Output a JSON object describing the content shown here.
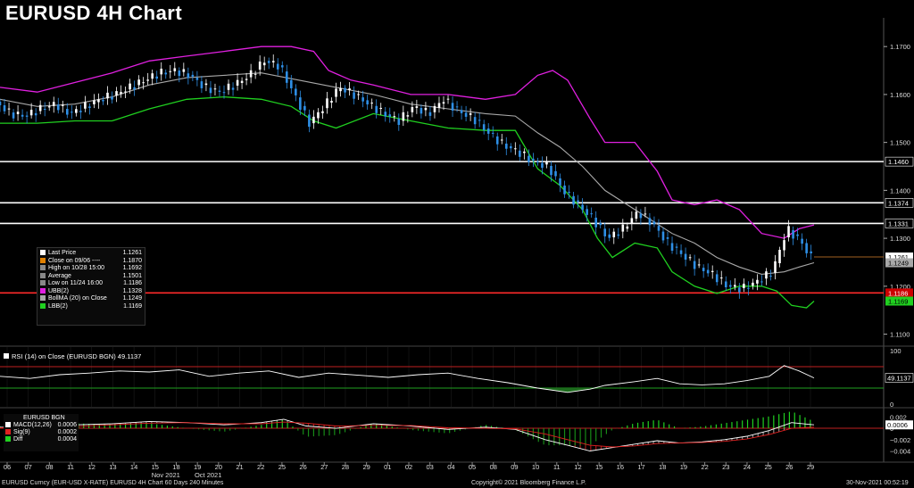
{
  "title": "EURUSD 4H Chart",
  "colors": {
    "background": "#000000",
    "candle_up": "#ffffff",
    "candle_down": "#2e8fe6",
    "upper_band": "#e020e0",
    "average": "#a8a8a8",
    "lower_band": "#20d020",
    "support_line": "#ff2a2a",
    "resistance_line": "#ffffff"
  },
  "legend": [
    {
      "label": "Last Price",
      "value": "1.1261",
      "color": "#ffffff"
    },
    {
      "label": "Close on 09/06 ----",
      "value": "1.1870",
      "color": "#e08000"
    },
    {
      "label": "High on 10/28 15:00",
      "value": "1.1692",
      "color": "#888888"
    },
    {
      "label": "Average",
      "value": "1.1501",
      "color": "#888888"
    },
    {
      "label": "Low on 11/24 16:00",
      "value": "1.1186",
      "color": "#888888"
    },
    {
      "label": "UBB(2)",
      "value": "1.1328",
      "color": "#e020e0"
    },
    {
      "label": "BollMA (20)  on Close",
      "value": "1.1249",
      "color": "#a8a8a8"
    },
    {
      "label": "LBB(2)",
      "value": "1.1169",
      "color": "#20d020"
    }
  ],
  "rsi": {
    "label": "RSI (14)  on Close (EURUSD BGN)",
    "value": "49.1137"
  },
  "macd_legend": {
    "title": "EURUSD BGN",
    "rows": [
      {
        "label": "MACD(12,26)",
        "value": "0.0006",
        "color": "#ffffff"
      },
      {
        "label": "Sig(9)",
        "value": "0.0002",
        "color": "#e02020"
      },
      {
        "label": "Diff",
        "value": "0.0004",
        "color": "#20d020"
      }
    ]
  },
  "footer": {
    "left": "EURUSD Curncy (EUR-USD X-RATE) EURUSD 4H Chart 60 Days 240 Minutes",
    "center": "Copyright© 2021 Bloomberg Finance L.P.",
    "right": "30-Nov-2021 00:52:19"
  },
  "chart_data": {
    "type": "candlestick",
    "title": "EURUSD 4H Chart",
    "x_ticks": [
      "06",
      "07",
      "08",
      "11",
      "12",
      "13",
      "14",
      "15",
      "18",
      "19",
      "20",
      "21",
      "22",
      "25",
      "26",
      "27",
      "28",
      "29",
      "01",
      "02",
      "03",
      "04",
      "05",
      "08",
      "09",
      "10",
      "11",
      "12",
      "15",
      "16",
      "17",
      "18",
      "19",
      "22",
      "23",
      "24",
      "25",
      "26",
      "29"
    ],
    "month_labels": [
      {
        "text": "Oct 2021",
        "after_tick": "19"
      },
      {
        "text": "Nov 2021",
        "after_tick": "15"
      }
    ],
    "y_ticks": [
      1.17,
      1.16,
      1.15,
      1.14,
      1.13,
      1.12,
      1.11
    ],
    "ylim": [
      1.1075,
      1.1745
    ],
    "horizontal_lines": [
      {
        "value": 1.146,
        "label": "1.1460",
        "color": "#ffffff"
      },
      {
        "value": 1.1374,
        "label": "1.1374",
        "color": "#ffffff"
      },
      {
        "value": 1.1331,
        "label": "1.1331",
        "color": "#ffffff"
      },
      {
        "value": 1.1186,
        "label": "1.1186",
        "color": "#ff2a2a"
      }
    ],
    "price_tags": [
      {
        "value": 1.1261,
        "label": "1.1261",
        "bg": "#ffffff",
        "fg": "#000000"
      },
      {
        "value": 1.1249,
        "label": "1.1249",
        "bg": "#a8a8a8",
        "fg": "#000000"
      },
      {
        "value": 1.1169,
        "label": "1.1169",
        "bg": "#20d020",
        "fg": "#000000"
      }
    ],
    "close_path": [
      [
        0,
        1.1585
      ],
      [
        4,
        1.156
      ],
      [
        8,
        1.1555
      ],
      [
        12,
        1.157
      ],
      [
        16,
        1.158
      ],
      [
        20,
        1.156
      ],
      [
        24,
        1.1575
      ],
      [
        28,
        1.159
      ],
      [
        32,
        1.16
      ],
      [
        36,
        1.1615
      ],
      [
        40,
        1.163
      ],
      [
        44,
        1.1645
      ],
      [
        48,
        1.165
      ],
      [
        52,
        1.164
      ],
      [
        56,
        1.1615
      ],
      [
        60,
        1.1605
      ],
      [
        64,
        1.162
      ],
      [
        68,
        1.164
      ],
      [
        72,
        1.167
      ],
      [
        76,
        1.166
      ],
      [
        80,
        1.16
      ],
      [
        84,
        1.154
      ],
      [
        88,
        1.1575
      ],
      [
        92,
        1.1615
      ],
      [
        96,
        1.16
      ],
      [
        100,
        1.158
      ],
      [
        104,
        1.156
      ],
      [
        108,
        1.1545
      ],
      [
        112,
        1.1575
      ],
      [
        116,
        1.156
      ],
      [
        120,
        1.159
      ],
      [
        124,
        1.1565
      ],
      [
        128,
        1.155
      ],
      [
        132,
        1.152
      ],
      [
        136,
        1.1495
      ],
      [
        140,
        1.148
      ],
      [
        144,
        1.146
      ],
      [
        148,
        1.145
      ],
      [
        152,
        1.14
      ],
      [
        156,
        1.137
      ],
      [
        160,
        1.134
      ],
      [
        164,
        1.13
      ],
      [
        168,
        1.132
      ],
      [
        172,
        1.1355
      ],
      [
        176,
        1.133
      ],
      [
        180,
        1.129
      ],
      [
        184,
        1.1265
      ],
      [
        188,
        1.124
      ],
      [
        192,
        1.1225
      ],
      [
        196,
        1.12
      ],
      [
        200,
        1.1195
      ],
      [
        204,
        1.121
      ],
      [
        208,
        1.123
      ],
      [
        212,
        1.132
      ],
      [
        216,
        1.129
      ],
      [
        218,
        1.1261
      ]
    ],
    "upper_band_path": [
      [
        0,
        1.1615
      ],
      [
        10,
        1.1605
      ],
      [
        20,
        1.1625
      ],
      [
        30,
        1.1645
      ],
      [
        40,
        1.167
      ],
      [
        50,
        1.168
      ],
      [
        60,
        1.169
      ],
      [
        70,
        1.17
      ],
      [
        78,
        1.17
      ],
      [
        84,
        1.169
      ],
      [
        88,
        1.165
      ],
      [
        94,
        1.163
      ],
      [
        100,
        1.162
      ],
      [
        110,
        1.16
      ],
      [
        120,
        1.16
      ],
      [
        130,
        1.159
      ],
      [
        138,
        1.16
      ],
      [
        144,
        1.164
      ],
      [
        148,
        1.165
      ],
      [
        152,
        1.163
      ],
      [
        158,
        1.155
      ],
      [
        162,
        1.15
      ],
      [
        170,
        1.15
      ],
      [
        176,
        1.144
      ],
      [
        180,
        1.138
      ],
      [
        186,
        1.137
      ],
      [
        192,
        1.138
      ],
      [
        198,
        1.136
      ],
      [
        204,
        1.131
      ],
      [
        210,
        1.13
      ],
      [
        214,
        1.132
      ],
      [
        218,
        1.1328
      ]
    ],
    "average_path": [
      [
        0,
        1.159
      ],
      [
        10,
        1.1575
      ],
      [
        20,
        1.158
      ],
      [
        30,
        1.1595
      ],
      [
        40,
        1.162
      ],
      [
        50,
        1.1635
      ],
      [
        60,
        1.164
      ],
      [
        70,
        1.1645
      ],
      [
        80,
        1.163
      ],
      [
        90,
        1.1615
      ],
      [
        100,
        1.16
      ],
      [
        110,
        1.158
      ],
      [
        120,
        1.157
      ],
      [
        130,
        1.156
      ],
      [
        138,
        1.1555
      ],
      [
        144,
        1.152
      ],
      [
        150,
        1.149
      ],
      [
        156,
        1.145
      ],
      [
        162,
        1.14
      ],
      [
        168,
        1.137
      ],
      [
        174,
        1.134
      ],
      [
        180,
        1.131
      ],
      [
        186,
        1.129
      ],
      [
        192,
        1.126
      ],
      [
        198,
        1.124
      ],
      [
        204,
        1.1225
      ],
      [
        210,
        1.123
      ],
      [
        214,
        1.124
      ],
      [
        218,
        1.1249
      ]
    ],
    "lower_band_path": [
      [
        0,
        1.154
      ],
      [
        10,
        1.154
      ],
      [
        20,
        1.1545
      ],
      [
        30,
        1.1545
      ],
      [
        40,
        1.157
      ],
      [
        50,
        1.159
      ],
      [
        60,
        1.1595
      ],
      [
        70,
        1.159
      ],
      [
        78,
        1.1575
      ],
      [
        84,
        1.1545
      ],
      [
        90,
        1.153
      ],
      [
        100,
        1.156
      ],
      [
        110,
        1.1545
      ],
      [
        120,
        1.153
      ],
      [
        130,
        1.1525
      ],
      [
        138,
        1.1525
      ],
      [
        144,
        1.1445
      ],
      [
        150,
        1.141
      ],
      [
        156,
        1.136
      ],
      [
        160,
        1.13
      ],
      [
        164,
        1.126
      ],
      [
        170,
        1.129
      ],
      [
        176,
        1.128
      ],
      [
        180,
        1.123
      ],
      [
        186,
        1.12
      ],
      [
        192,
        1.1185
      ],
      [
        198,
        1.12
      ],
      [
        204,
        1.12
      ],
      [
        208,
        1.119
      ],
      [
        212,
        1.116
      ],
      [
        216,
        1.1155
      ],
      [
        218,
        1.1169
      ]
    ],
    "rsi_ylim": [
      0,
      100
    ],
    "rsi_ticks": [
      100,
      0
    ],
    "rsi_levels": [
      70,
      30
    ],
    "rsi_path": [
      [
        0,
        52
      ],
      [
        8,
        48
      ],
      [
        16,
        55
      ],
      [
        24,
        58
      ],
      [
        32,
        62
      ],
      [
        40,
        60
      ],
      [
        48,
        64
      ],
      [
        56,
        52
      ],
      [
        64,
        58
      ],
      [
        72,
        62
      ],
      [
        80,
        50
      ],
      [
        88,
        58
      ],
      [
        96,
        54
      ],
      [
        104,
        50
      ],
      [
        112,
        55
      ],
      [
        120,
        58
      ],
      [
        128,
        48
      ],
      [
        136,
        40
      ],
      [
        144,
        30
      ],
      [
        152,
        22
      ],
      [
        158,
        28
      ],
      [
        162,
        35
      ],
      [
        170,
        42
      ],
      [
        176,
        48
      ],
      [
        182,
        38
      ],
      [
        188,
        36
      ],
      [
        194,
        38
      ],
      [
        200,
        44
      ],
      [
        206,
        52
      ],
      [
        210,
        72
      ],
      [
        214,
        62
      ],
      [
        218,
        49
      ]
    ],
    "macd_ylim": [
      -0.0055,
      0.003
    ],
    "macd_ticks": [
      0.002,
      0,
      -0.002,
      -0.004
    ],
    "macd_path": [
      [
        0,
        0.0002
      ],
      [
        10,
        0.0
      ],
      [
        20,
        0.0006
      ],
      [
        30,
        0.0008
      ],
      [
        40,
        0.0012
      ],
      [
        50,
        0.001
      ],
      [
        60,
        0.0006
      ],
      [
        70,
        0.001
      ],
      [
        76,
        0.0016
      ],
      [
        82,
        0.0004
      ],
      [
        90,
        0.0
      ],
      [
        100,
        0.0008
      ],
      [
        110,
        0.0004
      ],
      [
        120,
        -0.0002
      ],
      [
        130,
        0.0002
      ],
      [
        138,
        -0.0002
      ],
      [
        146,
        -0.002
      ],
      [
        152,
        -0.003
      ],
      [
        158,
        -0.004
      ],
      [
        164,
        -0.0034
      ],
      [
        170,
        -0.0028
      ],
      [
        176,
        -0.0022
      ],
      [
        182,
        -0.0026
      ],
      [
        188,
        -0.0024
      ],
      [
        194,
        -0.002
      ],
      [
        200,
        -0.0014
      ],
      [
        206,
        -0.0004
      ],
      [
        212,
        0.001
      ],
      [
        218,
        0.0006
      ]
    ],
    "signal_path": [
      [
        0,
        0.0001
      ],
      [
        10,
        0.0001
      ],
      [
        20,
        0.0003
      ],
      [
        30,
        0.0006
      ],
      [
        40,
        0.0009
      ],
      [
        50,
        0.001
      ],
      [
        60,
        0.0008
      ],
      [
        70,
        0.0008
      ],
      [
        76,
        0.0011
      ],
      [
        82,
        0.0009
      ],
      [
        90,
        0.0004
      ],
      [
        100,
        0.0005
      ],
      [
        110,
        0.0005
      ],
      [
        120,
        0.0001
      ],
      [
        130,
        0.0
      ],
      [
        138,
        -0.0001
      ],
      [
        146,
        -0.001
      ],
      [
        152,
        -0.002
      ],
      [
        158,
        -0.003
      ],
      [
        164,
        -0.0033
      ],
      [
        170,
        -0.0031
      ],
      [
        176,
        -0.0027
      ],
      [
        182,
        -0.0026
      ],
      [
        188,
        -0.0025
      ],
      [
        194,
        -0.0023
      ],
      [
        200,
        -0.0019
      ],
      [
        206,
        -0.0011
      ],
      [
        212,
        0.0
      ],
      [
        218,
        0.0002
      ]
    ]
  }
}
